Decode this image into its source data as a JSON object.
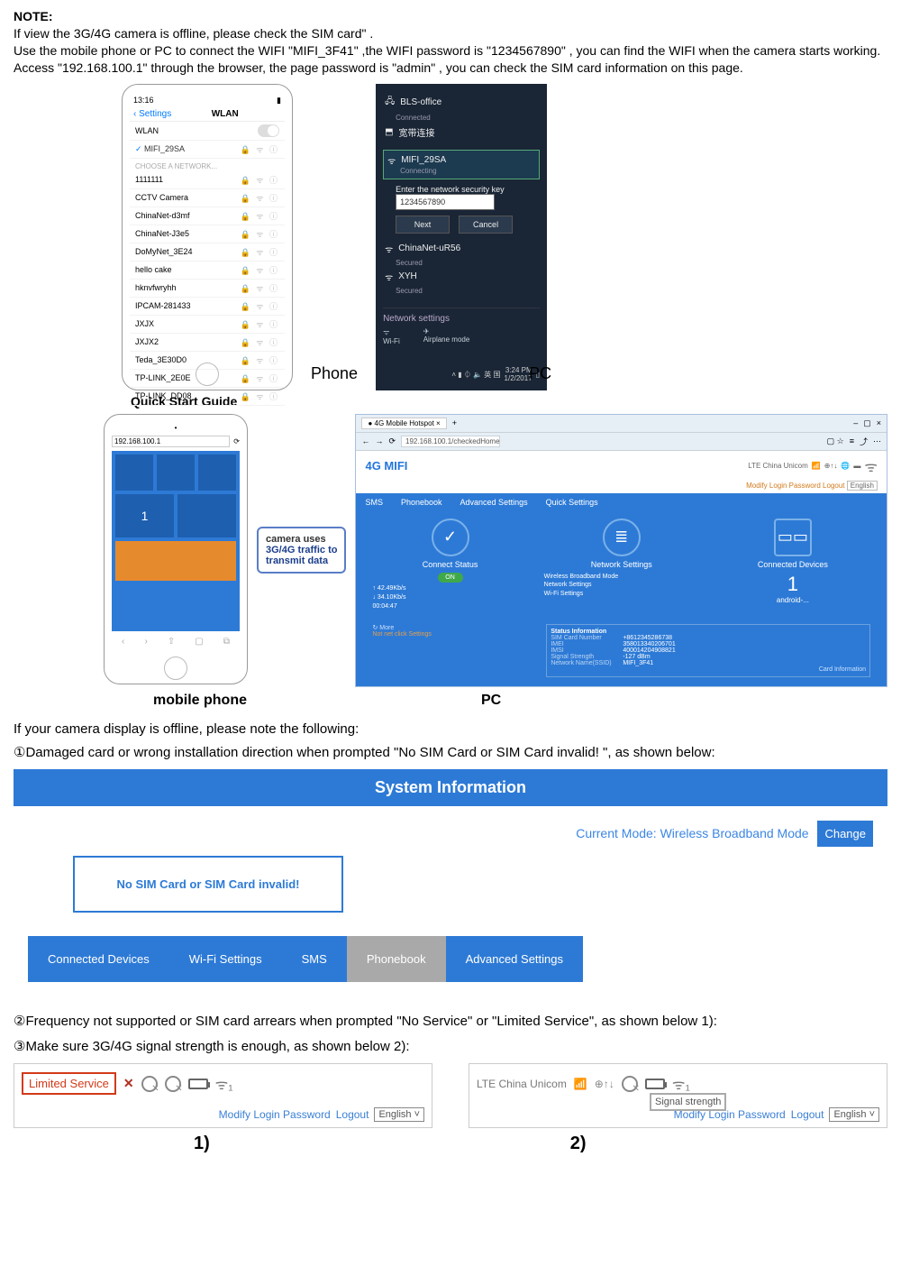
{
  "note": {
    "heading": "NOTE:",
    "line1": "If view the 3G/4G camera is offline, please check the SIM card\" .",
    "line2": "Use the mobile phone or PC to connect the WIFI \"MIFI_3F41\" ,the WIFI password is \"1234567890\" , you can find the WIFI when the camera starts working. Access \"192.168.100.1\" through the browser, the page password is \"admin\" , you can check the SIM card information on this page."
  },
  "ios": {
    "time": "13:16",
    "back": "Settings",
    "title": "WLAN",
    "wlan_label": "WLAN",
    "connected": "MIFI_29SA",
    "choose": "CHOOSE A NETWORK...",
    "networks": [
      "1111111",
      "CCTV Camera",
      "ChinaNet-d3mf",
      "ChinaNet-J3e5",
      "DoMyNet_3E24",
      "hello cake",
      "hknvfwryhh",
      "IPCAM-281433",
      "JXJX",
      "JXJX2",
      "Teda_3E30D0",
      "TP-LINK_2E0E",
      "TP-LINK_DD08"
    ]
  },
  "pc_wifi": {
    "bls": "BLS-office",
    "bls_sub": "Connected",
    "chinese": "宽带连接",
    "mifi": "MIFI_29SA",
    "mifi_sub": "Connecting",
    "enter_key": "Enter the network security key",
    "key_value": "1234567890",
    "next": "Next",
    "cancel": "Cancel",
    "net1": "ChinaNet-uR56",
    "net1_sub": "Secured",
    "net2": "XYH",
    "net2_sub": "Secured",
    "netset": "Network settings",
    "wifi_lbl": "Wi-Fi",
    "airplane": "Airplane mode",
    "time": "3:24 PM",
    "date": "1/2/2017"
  },
  "labels": {
    "phone": "Phone",
    "pc": "PC",
    "qsg": "Quick Start Guide",
    "mobile_phone": "mobile phone",
    "pc2": "PC"
  },
  "callout": {
    "l1": "camera uses",
    "l2": "3G/4G traffic to",
    "l3": "transmit data"
  },
  "admin": {
    "tab_title": "4G Mobile Hotspot",
    "url": "192.168.100.1/checkedHome",
    "title": "4G MIFI",
    "status_txt": "LTE   China Unicom",
    "modify_login": "Modify Login Password",
    "logout": "Logout",
    "lang": "English",
    "tabs": [
      "SMS",
      "Phonebook",
      "Advanced Settings",
      "Quick Settings"
    ],
    "card1_title": "Connect Status",
    "card1_up": "42.49Kb/s",
    "card1_down": "34.10Kb/s",
    "card1_time": "00:04:47",
    "card1_on": "ON",
    "card2_title": "Network Settings",
    "card2_r1": "Wireless Broadband Mode",
    "card2_r2": "Network Settings",
    "card2_r3": "Wi-Fi Settings",
    "card3_title": "Connected Devices",
    "card3_big": "1",
    "card3_sub": "android-...",
    "statinfo": "Status Information",
    "si_rows": [
      {
        "k": "SIM Card Number",
        "v": "+8612345286738"
      },
      {
        "k": "IMEI",
        "v": "358013340206701"
      },
      {
        "k": "IMSI",
        "v": "400014204908821"
      },
      {
        "k": "Signal Strength",
        "v": "-127 dBm"
      },
      {
        "k": "Network Name(SSID)",
        "v": "MIFI_3F41"
      }
    ],
    "more": "More",
    "noset": "Not net click Settings",
    "cardinfo": "Card Information"
  },
  "mobile_url": "192.168.100.1",
  "offline": {
    "intro": "If your camera display is offline, please note the following:",
    "i1": "①Damaged card or wrong installation direction when prompted \"No SIM Card or SIM Card invalid! \", as shown below:",
    "i2": "②Frequency not supported or SIM card arrears when prompted \"No Service\" or \"Limited Service\", as shown below 1):",
    "i3": "③Make sure 3G/4G signal strength is enough, as shown below 2):"
  },
  "sysinfo": {
    "title": "System Information",
    "curmode_lbl": "Current Mode:",
    "curmode_val": "Wireless Broadband Mode",
    "change": "Change",
    "no_sim": "No SIM Card or SIM Card invalid!",
    "tabs": [
      "Connected Devices",
      "Wi-Fi Settings",
      "SMS",
      "Phonebook",
      "Advanced Settings"
    ]
  },
  "sbar1": {
    "limited": "Limited Service",
    "modify": "Modify Login Password",
    "logout": "Logout",
    "lang": "English ˅"
  },
  "sbar2": {
    "lte": "LTE   China Unicom",
    "sig": "Signal strength",
    "modify": "Modify Login Password",
    "logout": "Logout",
    "lang": "English ˅"
  },
  "nums": {
    "one": "1)",
    "two": "2)"
  }
}
